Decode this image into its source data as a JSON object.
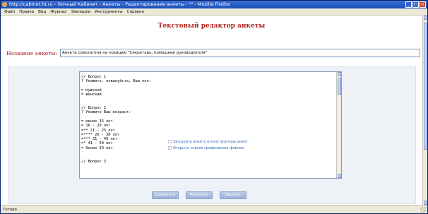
{
  "window": {
    "title": "http://cabinet.ht.ru - Личный Кабинет - Анкеты - Редактирование анкеты - \"\" - Mozilla Firefox"
  },
  "menubar": {
    "items": [
      "Файл",
      "Правка",
      "Вид",
      "Журнал",
      "Закладки",
      "Инструменты",
      "Справка"
    ]
  },
  "page": {
    "title": "Текстовый редактор анкеты",
    "name_label": "Название анкеты:",
    "name_value": "Анкета соискателя на позицию \"Секретарь, помощник руководителя\"",
    "editor_text": "// Вопрос 1\n? Укажите, пожалуйста, Ваш пол:\n\n= мужской\n= женский\n\n\n// Вопрос 2\n? Укажите Ваш возраст:\n\n= менее 16 лет\n= 16 - 20 лет\n=** 21 - 25 лет\n=**** 26 - 30 лет\n=*** 31 - 40 лет\n=* 41 - 50 лет\n= более 50 лет\n\n\n// Вопрос 3",
    "options": [
      "Загрузить анкету в конструкторе анкет",
      "Открыть список графических файлов"
    ],
    "buttons": {
      "save": "Сохранить",
      "preview": "Просмотр",
      "close": "Закрыть"
    }
  },
  "statusbar": {
    "text": "Готово"
  }
}
